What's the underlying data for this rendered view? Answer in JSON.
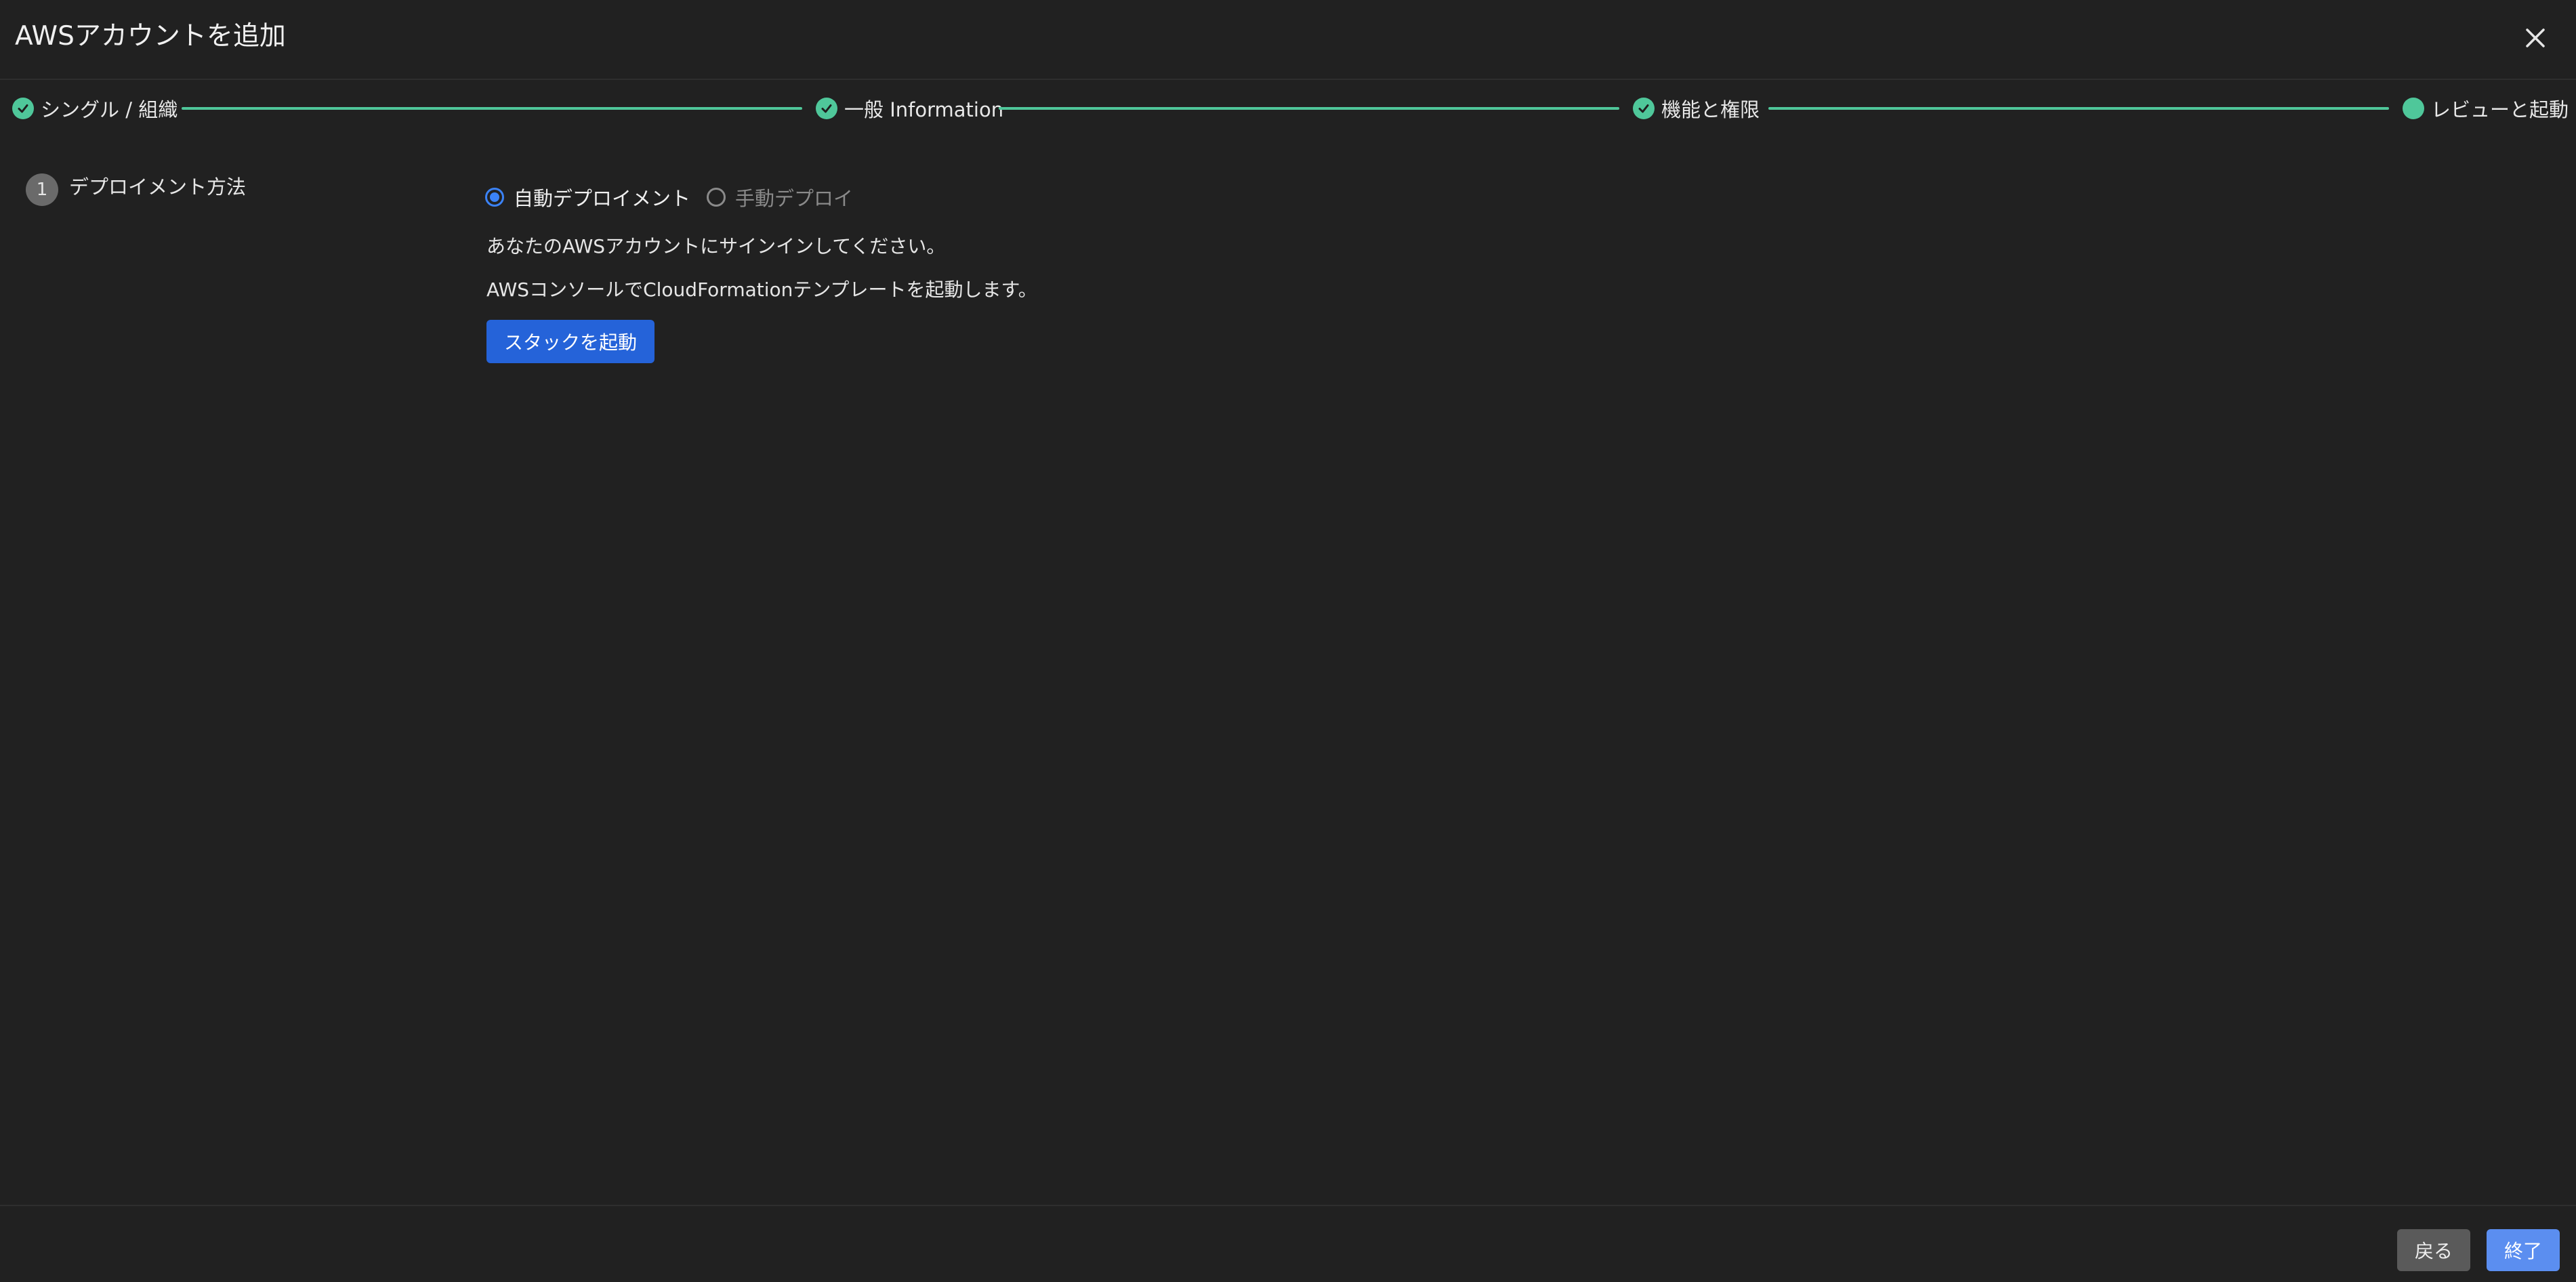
{
  "dialog": {
    "title": "AWSアカウントを追加"
  },
  "stepper": {
    "steps": [
      {
        "label": "シングル / 組織",
        "status": "completed"
      },
      {
        "label": "一般 Information",
        "status": "completed"
      },
      {
        "label": "機能と権限",
        "status": "completed"
      },
      {
        "label": "レビューと起動",
        "status": "current"
      }
    ]
  },
  "section": {
    "number": "1",
    "title": "デプロイメント方法"
  },
  "deployment": {
    "options": [
      {
        "label": "自動デプロイメント",
        "selected": true
      },
      {
        "label": "手動デプロイ",
        "selected": false
      }
    ],
    "instruction_1": "あなたのAWSアカウントにサインインしてください。",
    "instruction_2": "AWSコンソールでCloudFormationテンプレートを起動します。",
    "launch_button": "スタックを起動"
  },
  "footer": {
    "back_label": "戻る",
    "finish_label": "終了"
  },
  "colors": {
    "background": "#212121",
    "accent_green": "#4fc79a",
    "primary_blue": "#2563d9",
    "finish_blue": "#5b8ef0",
    "secondary_gray": "#5a5a5a"
  }
}
